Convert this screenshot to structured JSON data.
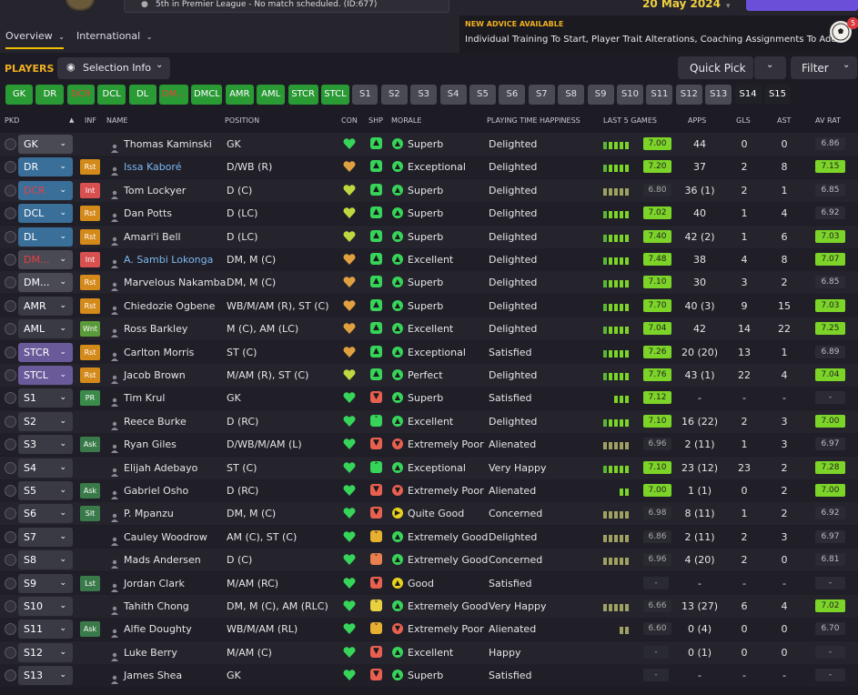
{
  "header": {
    "news": "5th in Premier League - No match scheduled. (ID:677)",
    "date": "20 May 2024",
    "tabs": [
      {
        "label": "Overview"
      },
      {
        "label": "International"
      }
    ],
    "advice_title": "NEW ADVICE AVAILABLE",
    "advice_text": "Individual Training To Start, Player Trait Alterations, Coaching Assignments To Add",
    "advice_count": "5"
  },
  "controls": {
    "players_label": "PLAYERS",
    "selection_info": "Selection Info",
    "quick_pick": "Quick Pick",
    "filter": "Filter"
  },
  "positions": [
    {
      "label": "GK",
      "style": "g"
    },
    {
      "label": "DR",
      "style": "g"
    },
    {
      "label": "DCR",
      "style": "r"
    },
    {
      "label": "DCL",
      "style": "g"
    },
    {
      "label": "DL",
      "style": "g"
    },
    {
      "label": "DM...",
      "style": "r"
    },
    {
      "label": "DMCL",
      "style": "g"
    },
    {
      "label": "AMR",
      "style": "g"
    },
    {
      "label": "AML",
      "style": "g"
    },
    {
      "label": "STCR",
      "style": "g"
    },
    {
      "label": "STCL",
      "style": "g"
    },
    {
      "label": "S1",
      "style": "s"
    },
    {
      "label": "S2",
      "style": "s"
    },
    {
      "label": "S3",
      "style": "s"
    },
    {
      "label": "S4",
      "style": "s"
    },
    {
      "label": "S5",
      "style": "s"
    },
    {
      "label": "S6",
      "style": "s"
    },
    {
      "label": "S7",
      "style": "s"
    },
    {
      "label": "S8",
      "style": "s"
    },
    {
      "label": "S9",
      "style": "s"
    },
    {
      "label": "S10",
      "style": "s"
    },
    {
      "label": "S11",
      "style": "s"
    },
    {
      "label": "S12",
      "style": "s"
    },
    {
      "label": "S13",
      "style": "s"
    },
    {
      "label": "S14",
      "style": "d"
    },
    {
      "label": "S15",
      "style": "d"
    }
  ],
  "columns": {
    "pkd": "PKD",
    "inf": "INF",
    "name": "NAME",
    "position": "POSITION",
    "con": "CON",
    "shp": "SHP",
    "morale": "MORALE",
    "happiness": "PLAYING TIME HAPPINESS",
    "last5": "LAST 5 GAMES",
    "apps": "APPS",
    "gls": "GLS",
    "ast": "AST",
    "avrat": "AV RAT"
  },
  "players": [
    {
      "slot": "GK",
      "slot_color": "#4a4a55",
      "slot_text": "#ffffff",
      "inf": "",
      "inf_color": "",
      "name": "Thomas Kaminski",
      "link": false,
      "position": "GK",
      "con": "#37d45a",
      "shp": "up",
      "shp_color": "#37d45a",
      "morale": "Superb",
      "morale_color": "#37d45a",
      "morale_icon": "up",
      "happiness": "Delighted",
      "last5": "7.00",
      "last5_green": true,
      "form": [
        1,
        1,
        1,
        1,
        1
      ],
      "apps": "44",
      "gls": "0",
      "ast": "0",
      "avrat": "6.86",
      "avrat_green": false
    },
    {
      "slot": "DR",
      "slot_color": "#3a6f9a",
      "slot_text": "#ffffff",
      "inf": "Rst",
      "inf_color": "#d48a1a",
      "name": "Issa Kaboré",
      "link": true,
      "position": "D/WB (R)",
      "con": "#e0a040",
      "shp": "up",
      "shp_color": "#37d45a",
      "morale": "Exceptional",
      "morale_color": "#37d45a",
      "morale_icon": "up",
      "happiness": "Delighted",
      "last5": "7.20",
      "last5_green": true,
      "form": [
        1,
        1,
        1,
        1,
        1
      ],
      "apps": "37",
      "gls": "2",
      "ast": "8",
      "avrat": "7.15",
      "avrat_green": true
    },
    {
      "slot": "DCR",
      "slot_color": "#3a6f9a",
      "slot_text": "#e84040",
      "inf": "Int",
      "inf_color": "#d85050",
      "name": "Tom Lockyer",
      "link": false,
      "position": "D (C)",
      "con": "#c0d840",
      "shp": "up",
      "shp_color": "#37d45a",
      "morale": "Superb",
      "morale_color": "#37d45a",
      "morale_icon": "up",
      "happiness": "Delighted",
      "last5": "6.80",
      "last5_green": false,
      "form": [
        1,
        1,
        1,
        1,
        1
      ],
      "apps": "36 (1)",
      "gls": "2",
      "ast": "1",
      "avrat": "6.85",
      "avrat_green": false
    },
    {
      "slot": "DCL",
      "slot_color": "#3a6f9a",
      "slot_text": "#ffffff",
      "inf": "Rst",
      "inf_color": "#d48a1a",
      "name": "Dan Potts",
      "link": false,
      "position": "D (LC)",
      "con": "#c0d840",
      "shp": "up",
      "shp_color": "#37d45a",
      "morale": "Superb",
      "morale_color": "#37d45a",
      "morale_icon": "up",
      "happiness": "Delighted",
      "last5": "7.02",
      "last5_green": true,
      "form": [
        1,
        1,
        1,
        1,
        1
      ],
      "apps": "40",
      "gls": "1",
      "ast": "4",
      "avrat": "6.92",
      "avrat_green": false
    },
    {
      "slot": "DL",
      "slot_color": "#3a6f9a",
      "slot_text": "#ffffff",
      "inf": "Rst",
      "inf_color": "#d48a1a",
      "name": "Amari'i Bell",
      "link": false,
      "position": "D (LC)",
      "con": "#c0d840",
      "shp": "up",
      "shp_color": "#37d45a",
      "morale": "Superb",
      "morale_color": "#37d45a",
      "morale_icon": "up",
      "happiness": "Delighted",
      "last5": "7.40",
      "last5_green": true,
      "form": [
        1,
        1,
        1,
        1,
        1
      ],
      "apps": "42 (2)",
      "gls": "1",
      "ast": "6",
      "avrat": "7.03",
      "avrat_green": true
    },
    {
      "slot": "DM...",
      "slot_color": "#4a4a55",
      "slot_text": "#e84040",
      "inf": "Int",
      "inf_color": "#d85050",
      "name": "A. Sambi Lokonga",
      "link": true,
      "position": "DM, M (C)",
      "con": "#e0a040",
      "shp": "up",
      "shp_color": "#37d45a",
      "morale": "Excellent",
      "morale_color": "#37d45a",
      "morale_icon": "up",
      "happiness": "Delighted",
      "last5": "7.48",
      "last5_green": true,
      "form": [
        1,
        1,
        1,
        1,
        1
      ],
      "apps": "38",
      "gls": "4",
      "ast": "8",
      "avrat": "7.07",
      "avrat_green": true
    },
    {
      "slot": "DM...",
      "slot_color": "#4a4a55",
      "slot_text": "#ffffff",
      "inf": "Rst",
      "inf_color": "#d48a1a",
      "name": "Marvelous Nakamba",
      "link": false,
      "position": "DM, M (C)",
      "con": "#e0a040",
      "shp": "up",
      "shp_color": "#37d45a",
      "morale": "Superb",
      "morale_color": "#37d45a",
      "morale_icon": "up",
      "happiness": "Delighted",
      "last5": "7.10",
      "last5_green": true,
      "form": [
        1,
        1,
        1,
        1,
        1
      ],
      "apps": "30",
      "gls": "3",
      "ast": "2",
      "avrat": "6.85",
      "avrat_green": false
    },
    {
      "slot": "AMR",
      "slot_color": "#3a3a45",
      "slot_text": "#ffffff",
      "inf": "Rst",
      "inf_color": "#d48a1a",
      "name": "Chiedozie Ogbene",
      "link": false,
      "position": "WB/M/AM (R), ST (C)",
      "con": "#e0a040",
      "shp": "up",
      "shp_color": "#37d45a",
      "morale": "Superb",
      "morale_color": "#37d45a",
      "morale_icon": "up",
      "happiness": "Delighted",
      "last5": "7.70",
      "last5_green": true,
      "form": [
        1,
        1,
        1,
        1,
        1
      ],
      "apps": "40 (3)",
      "gls": "9",
      "ast": "15",
      "avrat": "7.03",
      "avrat_green": true
    },
    {
      "slot": "AML",
      "slot_color": "#3a3a45",
      "slot_text": "#ffffff",
      "inf": "Wnt",
      "inf_color": "#5a9a3a",
      "name": "Ross Barkley",
      "link": false,
      "position": "M (C), AM (LC)",
      "con": "#e0a040",
      "shp": "up",
      "shp_color": "#37d45a",
      "morale": "Excellent",
      "morale_color": "#37d45a",
      "morale_icon": "up",
      "happiness": "Delighted",
      "last5": "7.04",
      "last5_green": true,
      "form": [
        1,
        1,
        1,
        1,
        1
      ],
      "apps": "42",
      "gls": "14",
      "ast": "22",
      "avrat": "7.25",
      "avrat_green": true
    },
    {
      "slot": "STCR",
      "slot_color": "#6a5a9a",
      "slot_text": "#ffffff",
      "inf": "Rst",
      "inf_color": "#d48a1a",
      "name": "Carlton Morris",
      "link": false,
      "position": "ST (C)",
      "con": "#e0a040",
      "shp": "up",
      "shp_color": "#37d45a",
      "morale": "Exceptional",
      "morale_color": "#37d45a",
      "morale_icon": "up",
      "happiness": "Satisfied",
      "last5": "7.26",
      "last5_green": true,
      "form": [
        1,
        1,
        1,
        1,
        1
      ],
      "apps": "20 (20)",
      "gls": "13",
      "ast": "1",
      "avrat": "6.89",
      "avrat_green": false
    },
    {
      "slot": "STCL",
      "slot_color": "#6a5a9a",
      "slot_text": "#ffffff",
      "inf": "Rst",
      "inf_color": "#d48a1a",
      "name": "Jacob Brown",
      "link": false,
      "position": "M/AM (R), ST (C)",
      "con": "#c0d840",
      "shp": "up",
      "shp_color": "#37d45a",
      "morale": "Perfect",
      "morale_color": "#37d45a",
      "morale_icon": "up",
      "happiness": "Delighted",
      "last5": "7.76",
      "last5_green": true,
      "form": [
        1,
        1,
        1,
        1,
        1
      ],
      "apps": "43 (1)",
      "gls": "22",
      "ast": "4",
      "avrat": "7.04",
      "avrat_green": true
    },
    {
      "slot": "S1",
      "slot_color": "#3a3a45",
      "slot_text": "#ffffff",
      "inf": "PR",
      "inf_color": "#3a8a4a",
      "name": "Tim Krul",
      "link": false,
      "position": "GK",
      "con": "#37d45a",
      "shp": "down",
      "shp_color": "#e86050",
      "morale": "Superb",
      "morale_color": "#37d45a",
      "morale_icon": "up",
      "happiness": "Satisfied",
      "last5": "7.12",
      "last5_green": true,
      "form": [
        0,
        0,
        1,
        1,
        1
      ],
      "apps": "-",
      "gls": "-",
      "ast": "-",
      "avrat": "-",
      "avrat_green": false
    },
    {
      "slot": "S2",
      "slot_color": "#3a3a45",
      "slot_text": "#ffffff",
      "inf": "",
      "inf_color": "",
      "name": "Reece Burke",
      "link": false,
      "position": "D (RC)",
      "con": "#37d45a",
      "shp": "vdown",
      "shp_color": "#37d45a",
      "morale": "Excellent",
      "morale_color": "#37d45a",
      "morale_icon": "up",
      "happiness": "Delighted",
      "last5": "7.10",
      "last5_green": true,
      "form": [
        1,
        1,
        1,
        1,
        1
      ],
      "apps": "16 (22)",
      "gls": "2",
      "ast": "3",
      "avrat": "7.00",
      "avrat_green": true
    },
    {
      "slot": "S3",
      "slot_color": "#3a3a45",
      "slot_text": "#ffffff",
      "inf": "Ask",
      "inf_color": "#3a7a4a",
      "name": "Ryan Giles",
      "link": false,
      "position": "D/WB/M/AM (L)",
      "con": "#37d45a",
      "shp": "down",
      "shp_color": "#e86050",
      "morale": "Extremely Poor",
      "morale_color": "#e86050",
      "morale_icon": "down",
      "happiness": "Alienated",
      "last5": "6.96",
      "last5_green": false,
      "form": [
        1,
        1,
        1,
        1,
        1
      ],
      "apps": "2 (11)",
      "gls": "1",
      "ast": "3",
      "avrat": "6.97",
      "avrat_green": false
    },
    {
      "slot": "S4",
      "slot_color": "#3a3a45",
      "slot_text": "#ffffff",
      "inf": "",
      "inf_color": "",
      "name": "Elijah Adebayo",
      "link": false,
      "position": "ST (C)",
      "con": "#37d45a",
      "shp": "vup",
      "shp_color": "#37d45a",
      "morale": "Exceptional",
      "morale_color": "#37d45a",
      "morale_icon": "up",
      "happiness": "Very Happy",
      "last5": "7.10",
      "last5_green": true,
      "form": [
        1,
        1,
        1,
        1,
        1
      ],
      "apps": "23 (12)",
      "gls": "23",
      "ast": "2",
      "avrat": "7.28",
      "avrat_green": true
    },
    {
      "slot": "S5",
      "slot_color": "#3a3a45",
      "slot_text": "#ffffff",
      "inf": "Ask",
      "inf_color": "#3a7a4a",
      "name": "Gabriel Osho",
      "link": false,
      "position": "D (RC)",
      "con": "#37d45a",
      "shp": "down",
      "shp_color": "#e86050",
      "morale": "Extremely Poor",
      "morale_color": "#e86050",
      "morale_icon": "down",
      "happiness": "Alienated",
      "last5": "7.00",
      "last5_green": true,
      "form": [
        0,
        0,
        0,
        1,
        1
      ],
      "apps": "1 (1)",
      "gls": "0",
      "ast": "2",
      "avrat": "7.00",
      "avrat_green": true
    },
    {
      "slot": "S6",
      "slot_color": "#3a3a45",
      "slot_text": "#ffffff",
      "inf": "Slt",
      "inf_color": "#3a7a4a",
      "name": "P. Mpanzu",
      "link": false,
      "position": "DM, M (C)",
      "con": "#37d45a",
      "shp": "down",
      "shp_color": "#e86050",
      "morale": "Quite Good",
      "morale_color": "#e8d020",
      "morale_icon": "right",
      "happiness": "Concerned",
      "last5": "6.98",
      "last5_green": false,
      "form": [
        1,
        1,
        1,
        1,
        1
      ],
      "apps": "8 (11)",
      "gls": "1",
      "ast": "2",
      "avrat": "6.92",
      "avrat_green": false
    },
    {
      "slot": "S7",
      "slot_color": "#3a3a45",
      "slot_text": "#ffffff",
      "inf": "",
      "inf_color": "",
      "name": "Cauley Woodrow",
      "link": false,
      "position": "AM (C), ST (C)",
      "con": "#37d45a",
      "shp": "vdown",
      "shp_color": "#e8b030",
      "morale": "Extremely Good",
      "morale_color": "#37d45a",
      "morale_icon": "up",
      "happiness": "Delighted",
      "last5": "6.86",
      "last5_green": false,
      "form": [
        1,
        1,
        1,
        1,
        1
      ],
      "apps": "2 (11)",
      "gls": "2",
      "ast": "3",
      "avrat": "6.97",
      "avrat_green": false
    },
    {
      "slot": "S8",
      "slot_color": "#3a3a45",
      "slot_text": "#ffffff",
      "inf": "",
      "inf_color": "",
      "name": "Mads Andersen",
      "link": false,
      "position": "D (C)",
      "con": "#37d45a",
      "shp": "vdown",
      "shp_color": "#e88050",
      "morale": "Extremely Good",
      "morale_color": "#37d45a",
      "morale_icon": "up",
      "happiness": "Concerned",
      "last5": "6.96",
      "last5_green": false,
      "form": [
        1,
        1,
        1,
        1,
        1
      ],
      "apps": "4 (20)",
      "gls": "2",
      "ast": "0",
      "avrat": "6.81",
      "avrat_green": false
    },
    {
      "slot": "S9",
      "slot_color": "#3a3a45",
      "slot_text": "#ffffff",
      "inf": "Lst",
      "inf_color": "#3a7a4a",
      "name": "Jordan Clark",
      "link": false,
      "position": "M/AM (RC)",
      "con": "#37d45a",
      "shp": "down",
      "shp_color": "#e86050",
      "morale": "Good",
      "morale_color": "#e8d020",
      "morale_icon": "up",
      "happiness": "Satisfied",
      "last5": "-",
      "last5_green": false,
      "form": [],
      "apps": "-",
      "gls": "-",
      "ast": "-",
      "avrat": "-",
      "avrat_green": false
    },
    {
      "slot": "S10",
      "slot_color": "#3a3a45",
      "slot_text": "#ffffff",
      "inf": "",
      "inf_color": "",
      "name": "Tahith Chong",
      "link": false,
      "position": "DM, M (C), AM (RLC)",
      "con": "#37d45a",
      "shp": "vdown",
      "shp_color": "#e8d040",
      "morale": "Extremely Good",
      "morale_color": "#37d45a",
      "morale_icon": "up",
      "happiness": "Very Happy",
      "last5": "6.66",
      "last5_green": false,
      "form": [
        1,
        1,
        1,
        1,
        1
      ],
      "apps": "13 (27)",
      "gls": "6",
      "ast": "4",
      "avrat": "7.02",
      "avrat_green": true
    },
    {
      "slot": "S11",
      "slot_color": "#3a3a45",
      "slot_text": "#ffffff",
      "inf": "Ask",
      "inf_color": "#3a7a4a",
      "name": "Alfie Doughty",
      "link": false,
      "position": "WB/M/AM (RL)",
      "con": "#37d45a",
      "shp": "vdown",
      "shp_color": "#e8b030",
      "morale": "Extremely Poor",
      "morale_color": "#e86050",
      "morale_icon": "down",
      "happiness": "Alienated",
      "last5": "6.60",
      "last5_green": false,
      "form": [
        0,
        0,
        0,
        1,
        1
      ],
      "apps": "0 (4)",
      "gls": "0",
      "ast": "0",
      "avrat": "6.70",
      "avrat_green": false
    },
    {
      "slot": "S12",
      "slot_color": "#3a3a45",
      "slot_text": "#ffffff",
      "inf": "",
      "inf_color": "",
      "name": "Luke Berry",
      "link": false,
      "position": "M/AM (C)",
      "con": "#37d45a",
      "shp": "down",
      "shp_color": "#e86050",
      "morale": "Excellent",
      "morale_color": "#37d45a",
      "morale_icon": "up",
      "happiness": "Happy",
      "last5": "-",
      "last5_green": false,
      "form": [],
      "apps": "0 (1)",
      "gls": "0",
      "ast": "0",
      "avrat": "-",
      "avrat_green": false
    },
    {
      "slot": "S13",
      "slot_color": "#3a3a45",
      "slot_text": "#ffffff",
      "inf": "",
      "inf_color": "",
      "name": "James Shea",
      "link": false,
      "position": "GK",
      "con": "#37d45a",
      "shp": "down",
      "shp_color": "#e86050",
      "morale": "Superb",
      "morale_color": "#37d45a",
      "morale_icon": "up",
      "happiness": "Satisfied",
      "last5": "-",
      "last5_green": false,
      "form": [],
      "apps": "-",
      "gls": "-",
      "ast": "-",
      "avrat": "-",
      "avrat_green": false
    }
  ]
}
